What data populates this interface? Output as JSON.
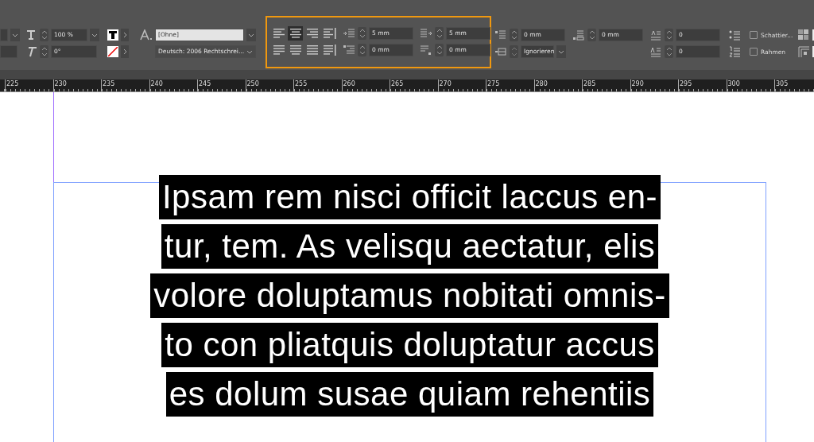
{
  "character_controls": {
    "scale_field": "100 %",
    "skew_field": "0°",
    "style_field": "[Ohne]",
    "language_field": "Deutsch: 2006 Rechtschrei..."
  },
  "alignment_buttons": [
    {
      "kind": "left",
      "selected": false
    },
    {
      "kind": "center",
      "selected": true
    },
    {
      "kind": "right",
      "selected": false
    },
    {
      "kind": "towards-spine",
      "selected": false
    },
    {
      "kind": "justify-left",
      "selected": false
    },
    {
      "kind": "justify-center",
      "selected": false
    },
    {
      "kind": "justify-all",
      "selected": false
    },
    {
      "kind": "away-spine",
      "selected": false
    }
  ],
  "indents": {
    "left": "5 mm",
    "right": "5 mm",
    "first_line": "0 mm",
    "last_line": "0 mm"
  },
  "spacing": {
    "before": "0 mm",
    "after": "0 mm",
    "grid_align": "Ignorieren"
  },
  "drop_cap": {
    "lines": "0",
    "characters": "0"
  },
  "options": [
    {
      "label": "Schattier...",
      "checked": false
    },
    {
      "label": "Rahmen",
      "checked": false
    }
  ],
  "ruler": [
    "225",
    "230",
    "235",
    "240",
    "245",
    "250",
    "255",
    "260",
    "265",
    "270",
    "275",
    "280",
    "285",
    "290",
    "295",
    "300",
    "305"
  ],
  "text_lines": [
    "Ipsam rem nisci officit laccus en-",
    "tur, tem. As velisqu aectatur, elis",
    "volore doluptamus nobitati omnis-",
    "to con pliatquis doluptatur accus",
    "es dolum susae quiam rehentiis"
  ]
}
